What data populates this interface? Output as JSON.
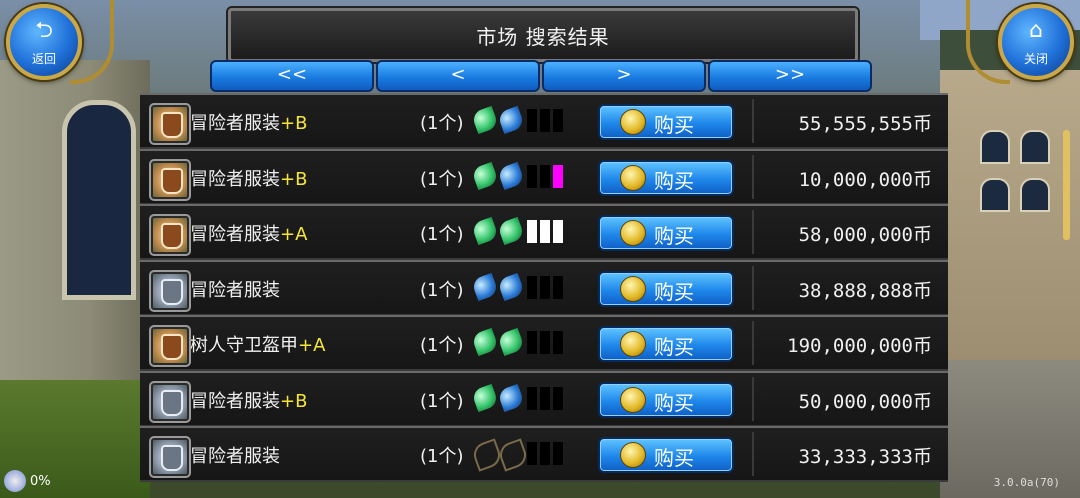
{
  "header": {
    "title": "市场  搜索结果",
    "back_label": "返回",
    "close_label": "关闭"
  },
  "pager": {
    "first": "<<",
    "prev": "<",
    "next": ">",
    "last": ">>"
  },
  "buy_label": "购买",
  "status": {
    "percent": "0%",
    "version": "3.0.0a(70)"
  },
  "colors": {
    "grade": "#f5e63a",
    "button_blue": "#1e86ea",
    "slot_magenta": "#ff00ff"
  },
  "items": [
    {
      "name": "冒险者服装",
      "grade": "+B",
      "qty": "(1个)",
      "icon": "leather-armor-icon",
      "gems": [
        "green",
        "blue"
      ],
      "slots": [
        "off",
        "off",
        "off"
      ],
      "price": "55,555,555币"
    },
    {
      "name": "冒险者服装",
      "grade": "+B",
      "qty": "(1个)",
      "icon": "leather-armor-icon",
      "gems": [
        "green",
        "blue"
      ],
      "slots": [
        "off",
        "off",
        "magenta"
      ],
      "price": "10,000,000币"
    },
    {
      "name": "冒险者服装",
      "grade": "+A",
      "qty": "(1个)",
      "icon": "leather-armor-icon",
      "gems": [
        "green",
        "green"
      ],
      "slots": [
        "white",
        "white",
        "white"
      ],
      "price": "58,000,000币"
    },
    {
      "name": "冒险者服装",
      "grade": "",
      "qty": "(1个)",
      "icon": "steel-armor-icon",
      "gems": [
        "blue",
        "blue"
      ],
      "slots": [
        "off",
        "off",
        "off"
      ],
      "price": "38,888,888币"
    },
    {
      "name": "树人守卫盔甲",
      "grade": "+A",
      "qty": "(1个)",
      "icon": "leather-armor-icon",
      "gems": [
        "green",
        "green"
      ],
      "slots": [
        "off",
        "off",
        "off"
      ],
      "price": "190,000,000币"
    },
    {
      "name": "冒险者服装",
      "grade": "+B",
      "qty": "(1个)",
      "icon": "steel-armor-icon",
      "gems": [
        "green",
        "blue"
      ],
      "slots": [
        "off",
        "off",
        "off"
      ],
      "price": "50,000,000币"
    },
    {
      "name": "冒险者服装",
      "grade": "",
      "qty": "(1个)",
      "icon": "steel-armor-icon",
      "gems": [
        "empty",
        "empty"
      ],
      "slots": [
        "off",
        "off",
        "off"
      ],
      "price": "33,333,333币"
    }
  ]
}
